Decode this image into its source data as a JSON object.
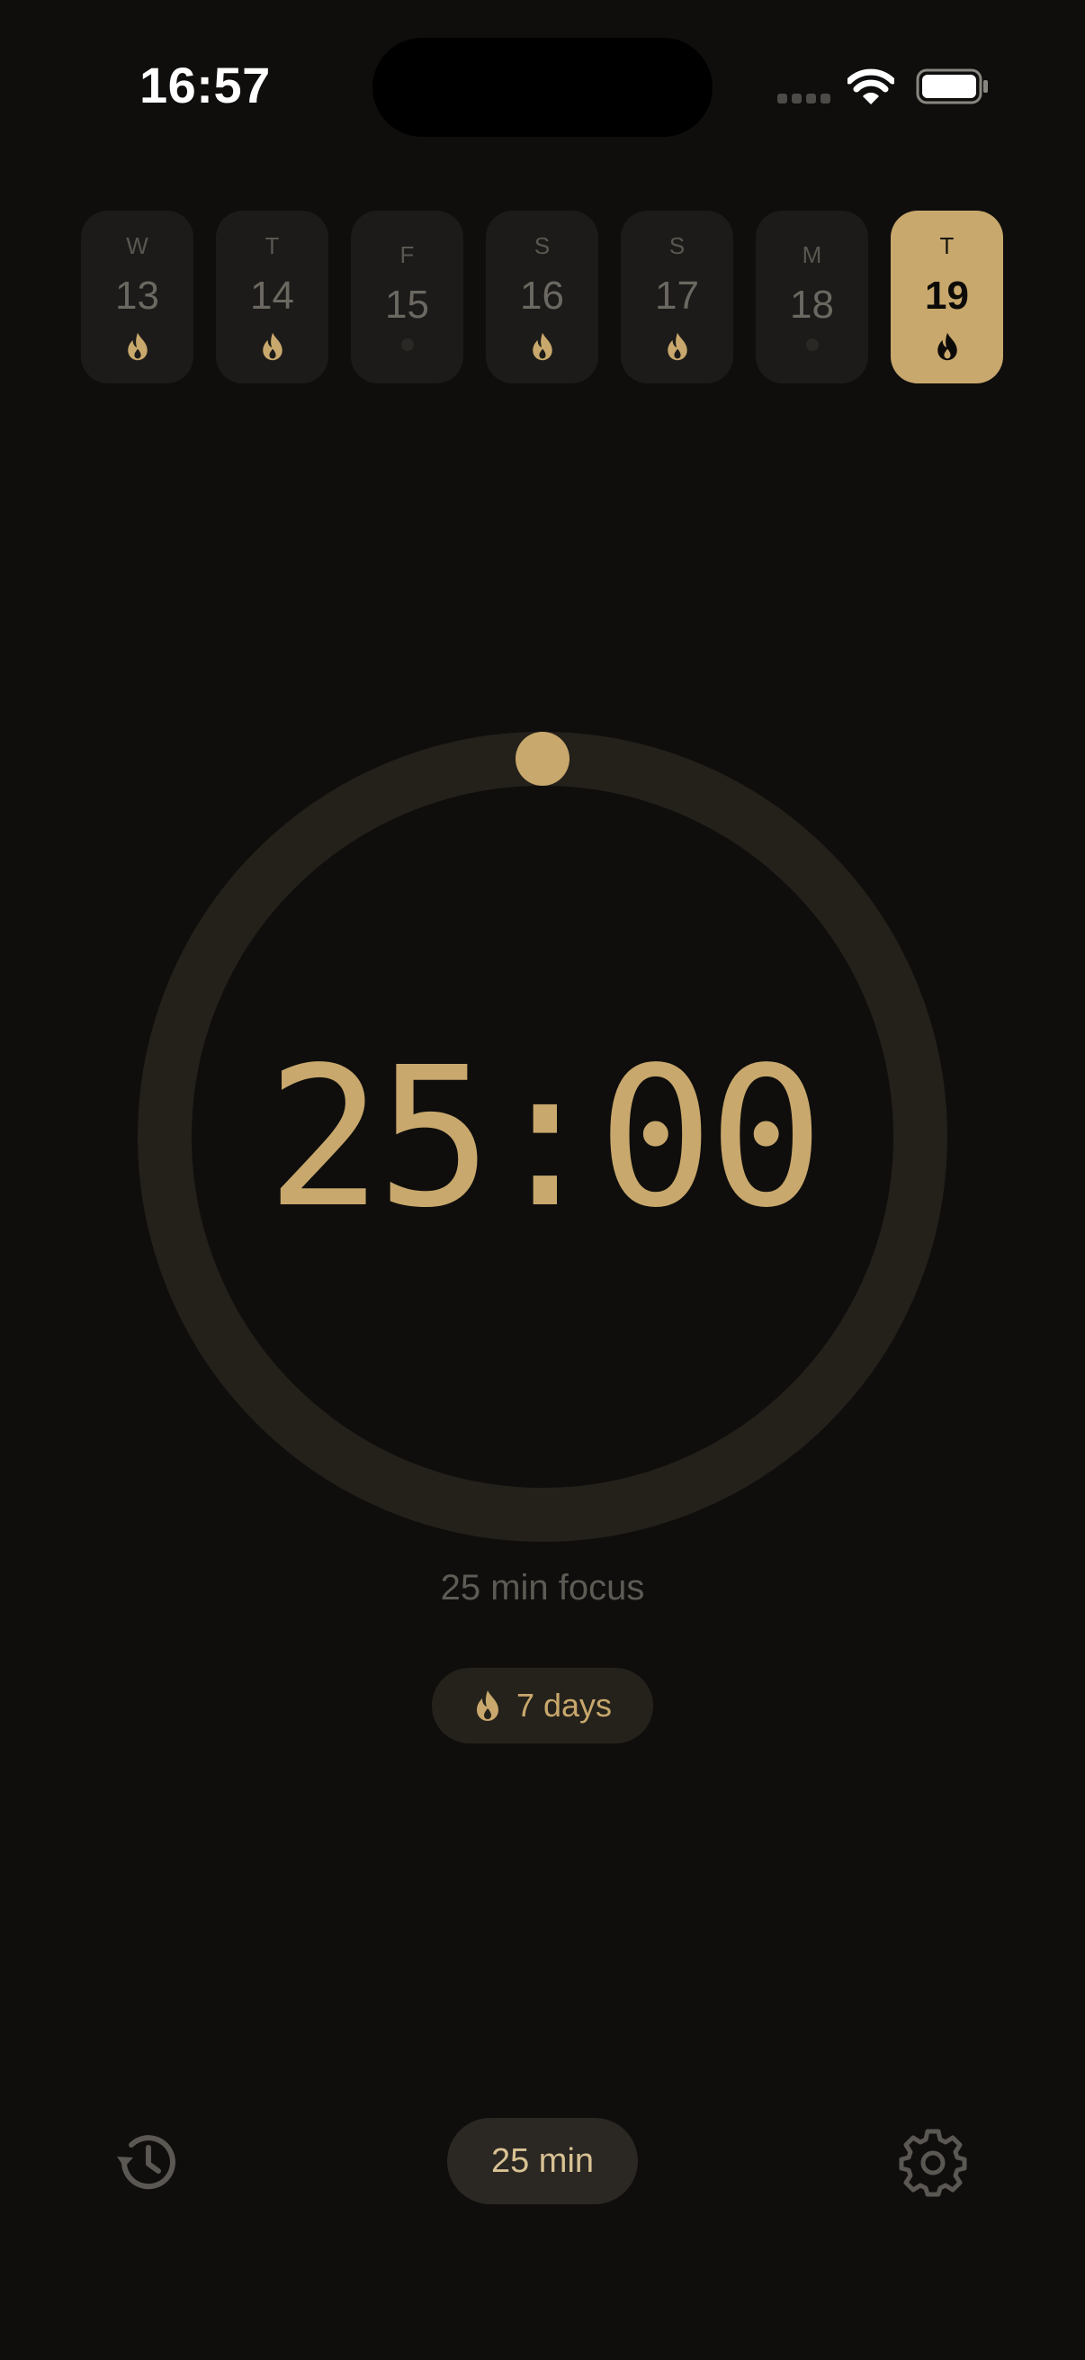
{
  "status_bar": {
    "time": "16:57"
  },
  "week": [
    {
      "letter": "W",
      "day": "13",
      "completed": true,
      "active": false
    },
    {
      "letter": "T",
      "day": "14",
      "completed": true,
      "active": false
    },
    {
      "letter": "F",
      "day": "15",
      "completed": false,
      "active": false
    },
    {
      "letter": "S",
      "day": "16",
      "completed": true,
      "active": false
    },
    {
      "letter": "S",
      "day": "17",
      "completed": true,
      "active": false
    },
    {
      "letter": "M",
      "day": "18",
      "completed": false,
      "active": false
    },
    {
      "letter": "T",
      "day": "19",
      "completed": true,
      "active": true
    }
  ],
  "timer": {
    "display": "25:00",
    "caption": "25 min focus",
    "progress": 0
  },
  "streak": {
    "label": "7 days",
    "icon": "flame-icon"
  },
  "bottom_bar": {
    "history_icon": "history-icon",
    "duration_label": "25 min",
    "settings_icon": "gear-icon"
  },
  "colors": {
    "background": "#0f0e0d",
    "accent": "#c8a86c",
    "ring_track": "#24201a",
    "chip": "#1c1b19"
  }
}
